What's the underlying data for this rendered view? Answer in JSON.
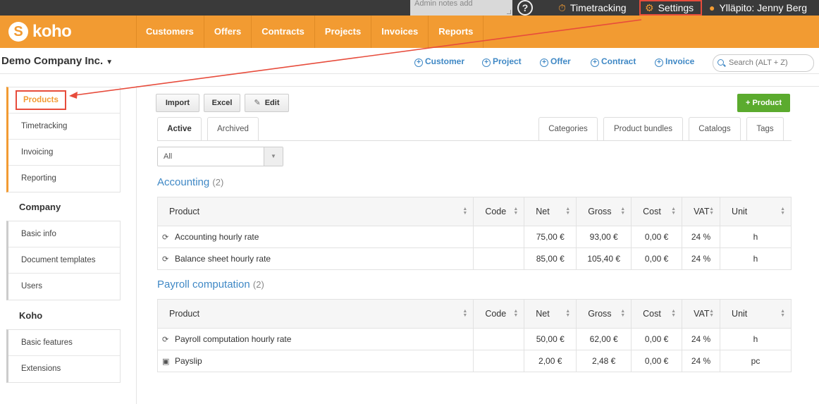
{
  "topbar": {
    "admin_notes_placeholder": "Admin notes add",
    "help": "?",
    "timetracking": "Timetracking",
    "settings": "Settings",
    "user": "Ylläpito: Jenny Berg"
  },
  "logo": {
    "mark": "S",
    "word": "koho"
  },
  "nav": {
    "items": [
      "Customers",
      "Offers",
      "Contracts",
      "Projects",
      "Invoices",
      "Reports"
    ]
  },
  "header": {
    "company": "Demo Company Inc.",
    "quick_links": [
      "Customer",
      "Project",
      "Offer",
      "Contract",
      "Invoice"
    ],
    "search_placeholder": "Search (ALT + Z)"
  },
  "sidebar": {
    "group1": [
      "Products",
      "Timetracking",
      "Invoicing",
      "Reporting"
    ],
    "heading2": "Company",
    "group2": [
      "Basic info",
      "Document templates",
      "Users"
    ],
    "heading3": "Koho",
    "group3": [
      "Basic features",
      "Extensions"
    ]
  },
  "toolbar": {
    "import": "Import",
    "excel": "Excel",
    "edit": "Edit",
    "add_product": "+ Product"
  },
  "tabs": {
    "active": "Active",
    "archived": "Archived",
    "categories": "Categories",
    "product_bundles": "Product bundles",
    "catalogs": "Catalogs",
    "tags": "Tags"
  },
  "filter": {
    "selected": "All"
  },
  "columns": [
    "Product",
    "Code",
    "Net",
    "Gross",
    "Cost",
    "VAT",
    "Unit"
  ],
  "sections": [
    {
      "title": "Accounting",
      "count": "(2)",
      "rows": [
        {
          "icon": "recurring-icon",
          "product": "Accounting hourly rate",
          "code": "",
          "net": "75,00 €",
          "gross": "93,00 €",
          "cost": "0,00 €",
          "vat": "24 %",
          "unit": "h"
        },
        {
          "icon": "recurring-icon",
          "product": "Balance sheet hourly rate",
          "code": "",
          "net": "85,00 €",
          "gross": "105,40 €",
          "cost": "0,00 €",
          "vat": "24 %",
          "unit": "h"
        }
      ]
    },
    {
      "title": "Payroll computation",
      "count": "(2)",
      "rows": [
        {
          "icon": "recurring-icon",
          "product": "Payroll computation hourly rate",
          "code": "",
          "net": "50,00 €",
          "gross": "62,00 €",
          "cost": "0,00 €",
          "vat": "24 %",
          "unit": "h"
        },
        {
          "icon": "box-icon",
          "product": "Payslip",
          "code": "",
          "net": "2,00 €",
          "gross": "2,48 €",
          "cost": "0,00 €",
          "vat": "24 %",
          "unit": "pc"
        }
      ]
    }
  ],
  "colors": {
    "brand_orange": "#f29b32",
    "link_blue": "#3f88c5",
    "annotation_red": "#e74c3c",
    "success_green": "#5bab2e"
  }
}
